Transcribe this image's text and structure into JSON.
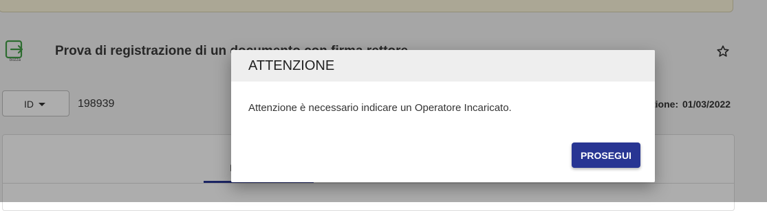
{
  "document": {
    "icon_label": "bozza",
    "title": "Prova di registrazione di un documento con firma rettore",
    "id_selector_label": "ID",
    "id_value": "198939",
    "date_label": "tione:",
    "date_value": "01/03/2022",
    "tab_letter": "I"
  },
  "dialog": {
    "title": "ATTENZIONE",
    "message": "Attenzione è necessario indicare un Operatore Incaricato.",
    "button_label": "PROSEGUI"
  },
  "colors": {
    "primary": "#283593",
    "overlay": "rgba(0,0,0,0.32)",
    "icon_green": "#43a047"
  }
}
